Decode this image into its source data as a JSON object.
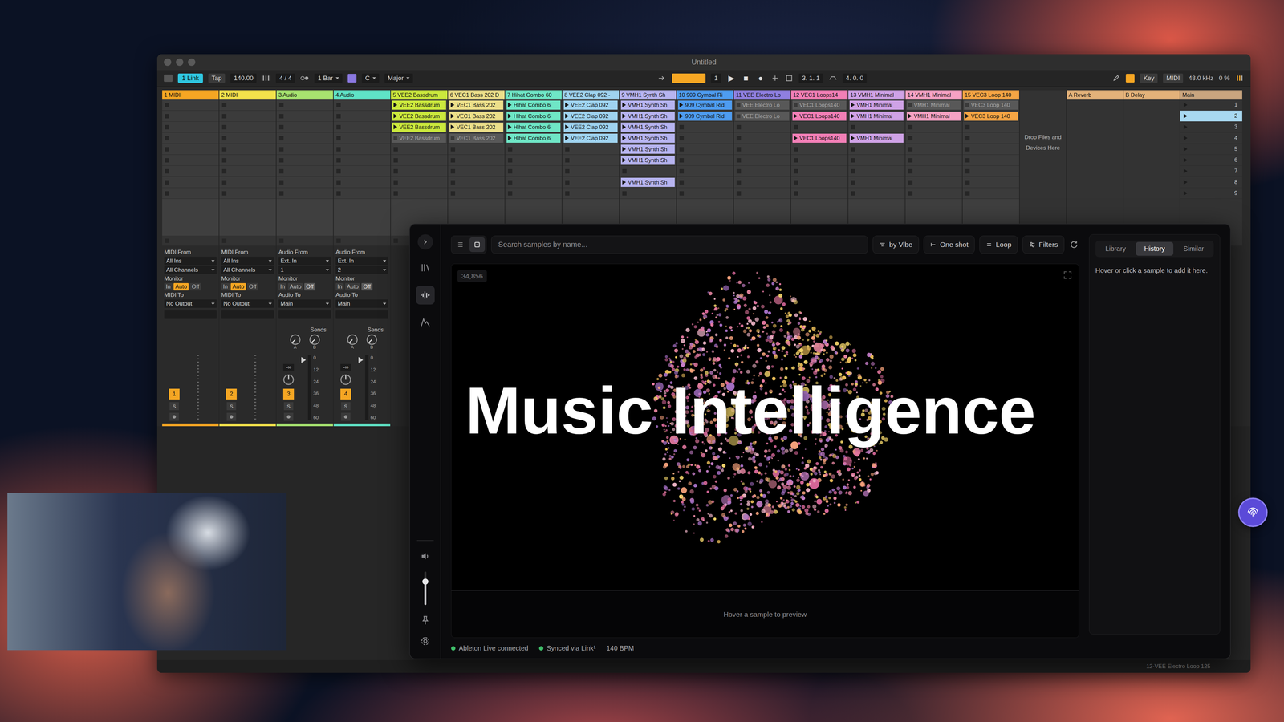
{
  "ableton": {
    "title": "Untitled",
    "toolbar": {
      "link": "1 Link",
      "tap": "Tap",
      "tempo": "140.00",
      "signature": "4 / 4",
      "quantize": "1 Bar",
      "key": "C",
      "scale": "Major",
      "position": "1",
      "play": "▶",
      "stop": "■",
      "record": "●",
      "arrangement_position": "3. 1. 1",
      "loop_length": "4. 0. 0",
      "key_map": "Key",
      "midi_map": "MIDI",
      "sample_rate": "48.0 kHz",
      "cpu": "0 %"
    },
    "tracks": [
      {
        "name": "1 MIDI",
        "color": "#f5a623",
        "clips": [
          null,
          null,
          null,
          null,
          null,
          null,
          null,
          null,
          null
        ]
      },
      {
        "name": "2 MIDI",
        "color": "#f3e24b",
        "clips": [
          null,
          null,
          null,
          null,
          null,
          null,
          null,
          null,
          null
        ]
      },
      {
        "name": "3 Audio",
        "color": "#a7e36f",
        "clips": [
          null,
          null,
          null,
          null,
          null,
          null,
          null,
          null,
          null
        ]
      },
      {
        "name": "4 Audio",
        "color": "#5fe3c6",
        "clips": [
          null,
          null,
          null,
          null,
          null,
          null,
          null,
          null,
          null
        ]
      },
      {
        "name": "5 VEE2 Bassdrum",
        "color": "#cbe83d",
        "clips": [
          {
            "name": "VEE2 Bassdrum",
            "active": true
          },
          {
            "name": "VEE2 Bassdrum",
            "active": true
          },
          {
            "name": "VEE2 Bassdrum",
            "active": true
          },
          {
            "name": "VEE2 Bassdrum",
            "active": false
          },
          null,
          null,
          null,
          null,
          null
        ]
      },
      {
        "name": "6 VEC1 Bass 202 D",
        "color": "#ecdf8a",
        "clips": [
          {
            "name": "VEC1 Bass 202",
            "active": true
          },
          {
            "name": "VEC1 Bass 202",
            "active": true
          },
          {
            "name": "VEC1 Bass 202",
            "active": true
          },
          {
            "name": "VEC1 Bass 202",
            "active": false
          },
          null,
          null,
          null,
          null,
          null
        ]
      },
      {
        "name": "7 Hihat Combo 60",
        "color": "#6fe6c6",
        "clips": [
          {
            "name": "Hihat Combo 6",
            "active": true
          },
          {
            "name": "Hihat Combo 6",
            "active": true
          },
          {
            "name": "Hihat Combo 6",
            "active": true
          },
          {
            "name": "Hihat Combo 6",
            "active": true
          },
          null,
          null,
          null,
          null,
          null
        ]
      },
      {
        "name": "8 VEE2 Clap 092 -",
        "color": "#9fd3ef",
        "clips": [
          {
            "name": "VEE2 Clap 092",
            "active": true
          },
          {
            "name": "VEE2 Clap 092",
            "active": true
          },
          {
            "name": "VEE2 Clap 092",
            "active": true
          },
          {
            "name": "VEE2 Clap 092",
            "active": true
          },
          null,
          null,
          null,
          null,
          null
        ]
      },
      {
        "name": "9 VMH1 Synth Sh",
        "color": "#b7b4f0",
        "clips": [
          {
            "name": "VMH1 Synth Sh",
            "active": true
          },
          {
            "name": "VMH1 Synth Sh",
            "active": true
          },
          {
            "name": "VMH1 Synth Sh",
            "active": true
          },
          {
            "name": "VMH1 Synth Sh",
            "active": true
          },
          {
            "name": "VMH1 Synth Sh",
            "active": true
          },
          {
            "name": "VMH1 Synth Sh",
            "active": true
          },
          null,
          {
            "name": "VMH1 Synth Sh",
            "active": true
          },
          null
        ]
      },
      {
        "name": "10 909 Cymbal Ri",
        "color": "#4e9cf0",
        "clips": [
          {
            "name": "909 Cymbal Rid",
            "active": true
          },
          {
            "name": "909 Cymbal Rid",
            "active": true
          },
          null,
          null,
          null,
          null,
          null,
          null,
          null
        ]
      },
      {
        "name": "11 VEE Electro Lo",
        "color": "#8f7fe0",
        "clips": [
          {
            "name": "VEE Electro Lo",
            "active": false
          },
          {
            "name": "VEE Electro Lo",
            "active": false
          },
          null,
          null,
          null,
          null,
          null,
          null,
          null
        ]
      },
      {
        "name": "12 VEC1 Loops14",
        "color": "#f27fb6",
        "clips": [
          {
            "name": "VEC1 Loops140",
            "active": false
          },
          {
            "name": "VEC1 Loops140",
            "active": true
          },
          null,
          {
            "name": "VEC1 Loops140",
            "active": true
          },
          null,
          null,
          null,
          null,
          null
        ]
      },
      {
        "name": "13 VMH1 Minimal",
        "color": "#cfa2e6",
        "clips": [
          {
            "name": "VMH1 Minimal",
            "active": true
          },
          {
            "name": "VMH1 Minimal",
            "active": true
          },
          null,
          {
            "name": "VMH1 Minimal",
            "active": true
          },
          null,
          null,
          null,
          null,
          null
        ]
      },
      {
        "name": "14 VMH1 Minimal",
        "color": "#f6a2c4",
        "clips": [
          {
            "name": "VMH1 Minimal",
            "active": false
          },
          {
            "name": "VMH1 Minimal",
            "active": true
          },
          null,
          null,
          null,
          null,
          null,
          null,
          null
        ]
      },
      {
        "name": "15 VEC3 Loop 140",
        "color": "#f5a544",
        "clips": [
          {
            "name": "VEC3 Loop 140",
            "active": false
          },
          {
            "name": "VEC3 Loop 140",
            "active": true
          },
          null,
          null,
          null,
          null,
          null,
          null,
          null
        ]
      }
    ],
    "drop_hint": "Drop Files and Devices Here",
    "returns": [
      {
        "name": "A Reverb",
        "color": "#e3b27a"
      },
      {
        "name": "B Delay",
        "color": "#e3b27a"
      }
    ],
    "main": {
      "name": "Main",
      "color": "#c9a57f",
      "scenes": [
        {
          "number": "1",
          "selected": false
        },
        {
          "number": "2",
          "selected": true
        },
        {
          "number": "3",
          "selected": false
        },
        {
          "number": "4",
          "selected": false
        },
        {
          "number": "5",
          "selected": false
        },
        {
          "number": "6",
          "selected": false
        },
        {
          "number": "7",
          "selected": false
        },
        {
          "number": "8",
          "selected": false
        },
        {
          "number": "9",
          "selected": false
        }
      ]
    },
    "mixer": [
      {
        "kind": "midi",
        "from_label": "MIDI From",
        "from": "All Ins",
        "channel": "All Channels",
        "monitor_label": "Monitor",
        "monitor": [
          {
            "label": "In",
            "selected": false
          },
          {
            "label": "Auto",
            "selected": true
          },
          {
            "label": "Off",
            "selected": false
          }
        ],
        "to_label": "MIDI To",
        "to": "No Output",
        "number": "1",
        "solo": "S",
        "color": "#f5a623"
      },
      {
        "kind": "midi",
        "from_label": "MIDI From",
        "from": "All Ins",
        "channel": "All Channels",
        "monitor_label": "Monitor",
        "monitor": [
          {
            "label": "In",
            "selected": false
          },
          {
            "label": "Auto",
            "selected": true
          },
          {
            "label": "Off",
            "selected": false
          }
        ],
        "to_label": "MIDI To",
        "to": "No Output",
        "number": "2",
        "solo": "S",
        "color": "#f3e24b"
      },
      {
        "kind": "audio",
        "from_label": "Audio From",
        "from": "Ext. In",
        "channel": "1",
        "monitor_label": "Monitor",
        "monitor": [
          {
            "label": "In",
            "selected": false
          },
          {
            "label": "Auto",
            "selected": false
          },
          {
            "label": "Off",
            "selected": true
          }
        ],
        "to_label": "Audio To",
        "to": "Main",
        "sends_label": "Sends",
        "sends": [
          "A",
          "B"
        ],
        "volume": "-∞",
        "number": "3",
        "solo": "S",
        "color": "#a7e36f"
      },
      {
        "kind": "audio",
        "from_label": "Audio From",
        "from": "Ext. In",
        "channel": "2",
        "monitor_label": "Monitor",
        "monitor": [
          {
            "label": "In",
            "selected": false
          },
          {
            "label": "Auto",
            "selected": false
          },
          {
            "label": "Off",
            "selected": true
          }
        ],
        "to_label": "Audio To",
        "to": "Main",
        "sends_label": "Sends",
        "sends": [
          "A",
          "B"
        ],
        "volume": "-∞",
        "number": "4",
        "solo": "S",
        "color": "#5fe3c6"
      }
    ],
    "meter_scale": [
      "0",
      "12",
      "24",
      "36",
      "48",
      "60"
    ],
    "status": "12-VEE Electro Loop 125"
  },
  "plugin": {
    "rail": [
      {
        "kind": "library",
        "selected": false
      },
      {
        "kind": "waveform",
        "selected": true
      },
      {
        "kind": "envelope",
        "selected": false
      }
    ],
    "volume": {
      "level": 0.7
    },
    "view_toggle": [
      {
        "kind": "list",
        "selected": false
      },
      {
        "kind": "grid",
        "selected": true
      }
    ],
    "search_placeholder": "Search samples by name...",
    "filters": [
      {
        "label": "by Vibe",
        "kind": "sort"
      },
      {
        "label": "One shot",
        "kind": "oneshot"
      },
      {
        "label": "Loop",
        "kind": "loop"
      },
      {
        "label": "Filters",
        "kind": "filters"
      }
    ],
    "count": "34,856",
    "preview_hint": "Hover a sample to preview",
    "panel_tabs": [
      {
        "label": "Library",
        "selected": false
      },
      {
        "label": "History",
        "selected": true
      },
      {
        "label": "Similar",
        "selected": false
      }
    ],
    "panel_hint": "Hover or click a sample to add it here.",
    "status": [
      {
        "label": "Ableton Live connected",
        "on": true
      },
      {
        "label": "Synced via Link¹",
        "on": true
      }
    ],
    "bpm": "140 BPM"
  },
  "overlay_title": "Music Intelligence"
}
